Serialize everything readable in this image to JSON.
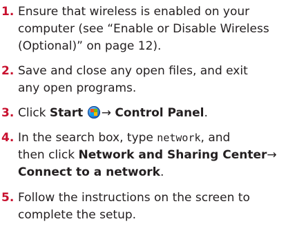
{
  "steps": [
    {
      "num": "1.",
      "line1": "Ensure that wireless is enabled on your",
      "line2": "computer (see “Enable or Disable Wireless",
      "line3": "(Optional)” on page 12)."
    },
    {
      "num": "2.",
      "line1": "Save and close any open files, and exit",
      "line2": "any open programs."
    },
    {
      "num": "3.",
      "pre": "Click",
      "start": "Start",
      "icon": "windows-start-orb-icon",
      "arrow": "→",
      "control_panel": "Control Panel",
      "end": "."
    },
    {
      "num": "4.",
      "pre": "In the search box, type",
      "code": "network",
      "post": ", and",
      "line2_pre": "then click",
      "network_center": "Network and Sharing Center",
      "arrow": "→",
      "connect": "Connect to a network",
      "end": "."
    },
    {
      "num": "5.",
      "line1": "Follow the instructions on the screen to",
      "line2": "complete the setup."
    }
  ],
  "colors": {
    "number": "#c8102e",
    "text": "#231f20"
  }
}
